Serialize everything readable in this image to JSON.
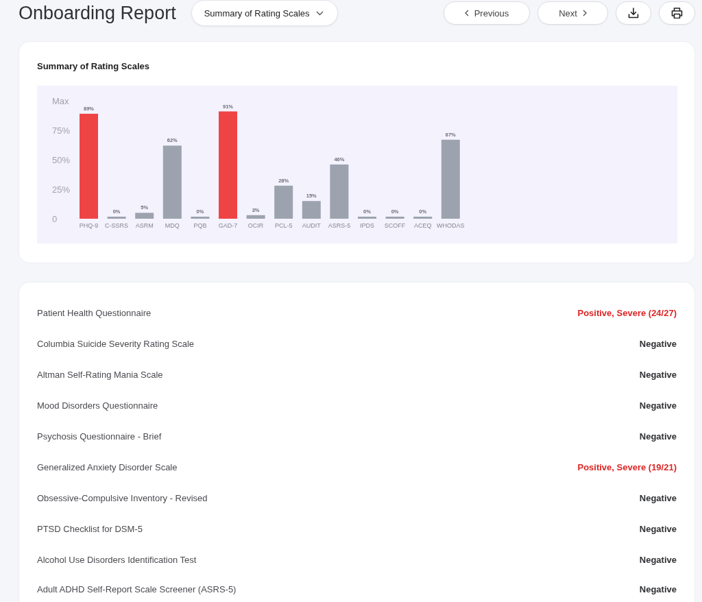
{
  "header": {
    "title": "Onboarding Report",
    "section_dropdown": {
      "value": "Summary of Rating Scales"
    },
    "buttons": [
      {
        "kind": "previous",
        "label": "Previous"
      },
      {
        "kind": "next",
        "label": "Next"
      },
      {
        "kind": "download"
      },
      {
        "kind": "print"
      }
    ]
  },
  "chart_card": {
    "title": "Summary of Rating Scales",
    "chart_data": {
      "type": "bar",
      "categories": [
        "PHQ-9",
        "C-SSRS",
        "ASRM",
        "MDQ",
        "PQB",
        "GAD-7",
        "OCIR",
        "PCL-5",
        "AUDIT",
        "ASRS-5",
        "IPDS",
        "SCOFF",
        "ACEQ",
        "WHODAS"
      ],
      "series": [
        {
          "color": "#ef4444",
          "values": [
            89,
            null,
            null,
            null,
            null,
            91,
            null,
            null,
            null,
            null,
            null,
            null,
            null,
            null
          ]
        },
        {
          "color": "#9ca3af",
          "values": [
            null,
            0,
            5,
            62,
            0,
            null,
            3,
            28,
            15,
            46,
            0,
            0,
            0,
            67
          ]
        }
      ],
      "stacked": true,
      "ylim": [
        0,
        100
      ],
      "yticks": [
        {
          "value": 0,
          "label": "0"
        },
        {
          "value": 25,
          "label": "25%"
        },
        {
          "value": 50,
          "label": "50%"
        },
        {
          "value": 75,
          "label": "75%"
        },
        {
          "value": 100,
          "label": "Max"
        }
      ],
      "value_labels": [
        "89%",
        "0%",
        "5%",
        "62%",
        "0%",
        "91%",
        "3%",
        "28%",
        "15%",
        "46%",
        "0%",
        "0%",
        "0%",
        "67%"
      ]
    }
  },
  "results": [
    {
      "name": "Patient Health Questionnaire",
      "result": "Positive, Severe (24/27)",
      "positive": true
    },
    {
      "name": "Columbia Suicide Severity Rating Scale",
      "result": "Negative",
      "positive": false
    },
    {
      "name": "Altman Self-Rating Mania Scale",
      "result": "Negative",
      "positive": false
    },
    {
      "name": "Mood Disorders Questionnaire",
      "result": "Negative",
      "positive": false
    },
    {
      "name": "Psychosis Questionnaire - Brief",
      "result": "Negative",
      "positive": false
    },
    {
      "name": "Generalized Anxiety Disorder Scale",
      "result": "Positive, Severe (19/21)",
      "positive": true
    },
    {
      "name": "Obsessive-Compulsive Inventory - Revised",
      "result": "Negative",
      "positive": false
    },
    {
      "name": "PTSD Checklist for DSM-5",
      "result": "Negative",
      "positive": false
    },
    {
      "name": "Alcohol Use Disorders Identification Test",
      "result": "Negative",
      "positive": false
    },
    {
      "name": "Adult ADHD Self-Report Scale Screener (ASRS-5)",
      "result": "Negative",
      "positive": false
    }
  ]
}
